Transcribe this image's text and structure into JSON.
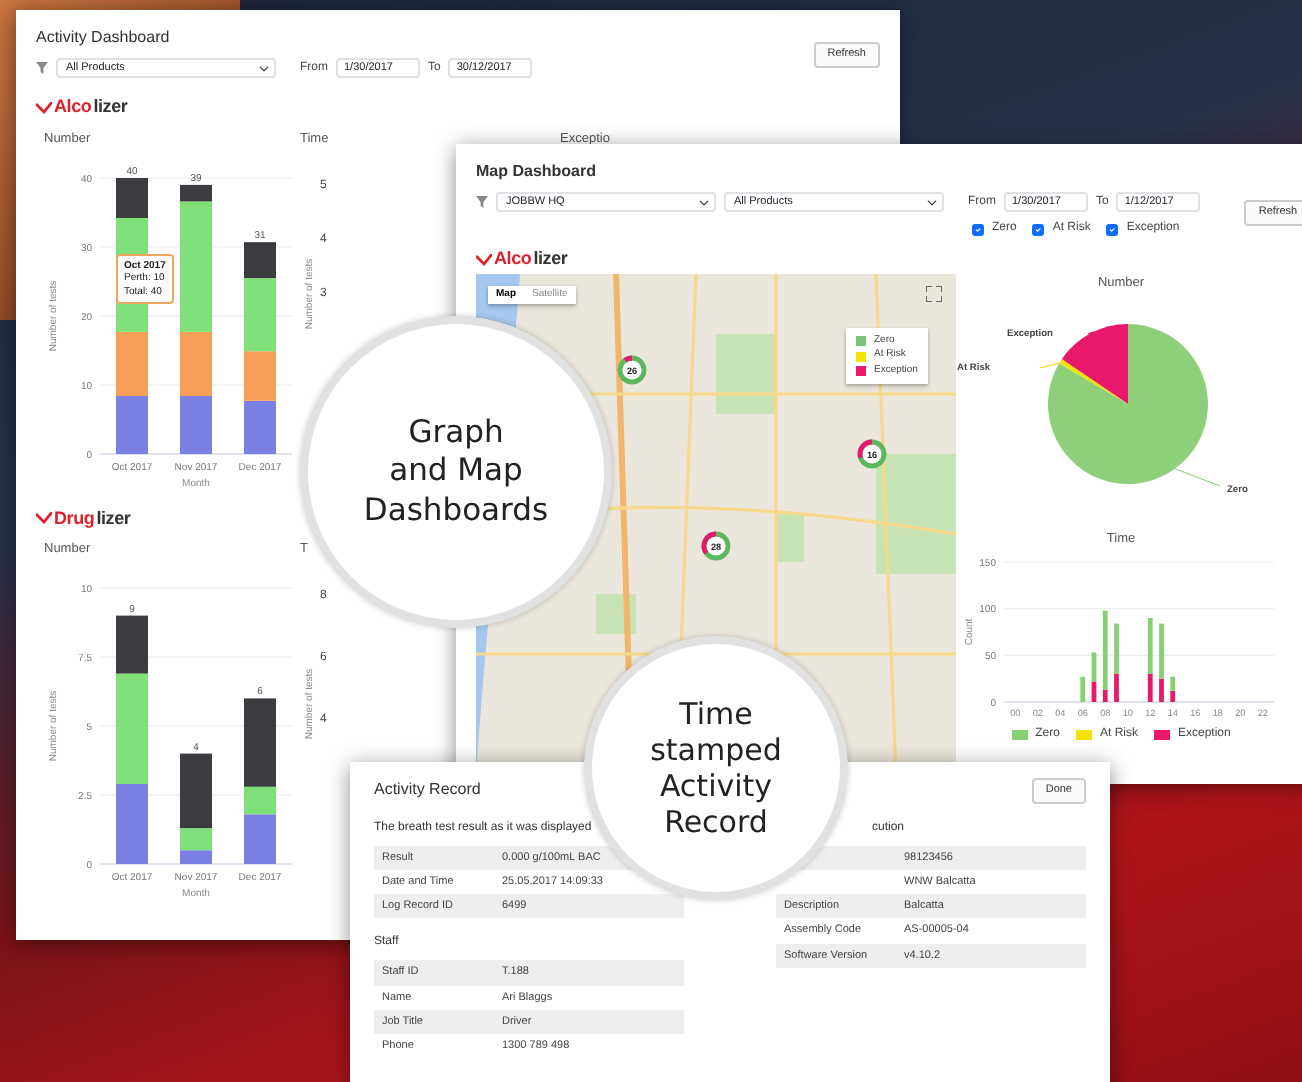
{
  "activity_dashboard": {
    "title": "Activity Dashboard",
    "product": "All Products",
    "from_label": "From",
    "from": "1/30/2017",
    "to_label": "To",
    "to": "30/12/2017",
    "refresh": "Refresh",
    "alcolizer": {
      "logo": {
        "accent": "Alco",
        "rest": "lizer"
      },
      "number_title": "Number",
      "tooltip": [
        "Oct 2017",
        "Perth: 10",
        "Total: 40"
      ],
      "chart_data": {
        "type": "bar",
        "stacked": true,
        "grid": true,
        "xlabel": "Month",
        "ylabel": "Number of tests",
        "categories": [
          "Oct 2017",
          "Nov 2017",
          "Dec 2017"
        ],
        "ylim": [
          0,
          40
        ],
        "yticks": [
          0,
          10,
          20,
          30,
          40
        ],
        "value_labels": [
          "40",
          "39",
          "31"
        ],
        "series": [
          {
            "color": "#7b7fe3",
            "values": [
              8.4,
              8.4,
              7.7
            ]
          },
          {
            "color": "#f5a05a",
            "values": [
              9.3,
              9.3,
              7.2
            ]
          },
          {
            "color": "#7fe07a",
            "values": [
              16.5,
              18.9,
              10.6
            ]
          },
          {
            "color": "#3b3b40",
            "values": [
              5.8,
              2.4,
              5.2
            ]
          }
        ]
      },
      "time_title": "Time",
      "time_ylabel": "Number of tests",
      "time_ticks": [
        "5",
        "4",
        "3"
      ],
      "exception_title": "Exceptio"
    },
    "druglizer": {
      "logo": {
        "accent": "Drug",
        "rest": "lizer"
      },
      "number_title": "Number",
      "chart_data": {
        "type": "bar",
        "stacked": true,
        "grid": true,
        "xlabel": "Month",
        "ylabel": "Number of tests",
        "categories": [
          "Oct 2017",
          "Nov 2017",
          "Dec 2017"
        ],
        "ylim": [
          0,
          10
        ],
        "yticks": [
          0,
          2.5,
          5,
          7.5,
          10
        ],
        "value_labels": [
          "9",
          "4",
          "6"
        ],
        "series": [
          {
            "color": "#7b7fe3",
            "values": [
              2.9,
              0.5,
              1.8
            ]
          },
          {
            "color": "#7fe07a",
            "values": [
              4.0,
              0.8,
              1.0
            ]
          },
          {
            "color": "#3b3b40",
            "values": [
              2.1,
              2.7,
              3.2
            ]
          }
        ]
      },
      "time_title": "T",
      "time_ylabel": "Number of tests",
      "time_ticks": [
        "8",
        "6",
        "4"
      ]
    }
  },
  "map_dashboard": {
    "title": "Map Dashboard",
    "site": "JOBBW HQ",
    "product": "All Products",
    "from_label": "From",
    "from": "1/30/2017",
    "to_label": "To",
    "to": "1/12/2017",
    "refresh": "Refresh",
    "filters": [
      {
        "label": "Zero",
        "checked": true
      },
      {
        "label": "At Risk",
        "checked": true
      },
      {
        "label": "Exception",
        "checked": true
      }
    ],
    "logo": {
      "accent": "Alco",
      "rest": "lizer"
    },
    "map": {
      "modes": [
        {
          "label": "Map",
          "selected": true
        },
        {
          "label": "Satellite",
          "selected": false
        }
      ],
      "legend": [
        {
          "label": "Zero",
          "color": "#7cc576"
        },
        {
          "label": "At Risk",
          "color": "#f0e400"
        },
        {
          "label": "Exception",
          "color": "#e8196b"
        }
      ],
      "markers": [
        {
          "count": "26"
        },
        {
          "count": "16"
        },
        {
          "count": "28"
        }
      ]
    },
    "number_panel": {
      "title": "Number",
      "slice_labels": [
        "Exception",
        "At Risk",
        "Zero"
      ]
    },
    "time_panel": {
      "title": "Time",
      "chart_data": {
        "type": "bar",
        "stacked": true,
        "grid": true,
        "ylabel": "Count",
        "x": [
          6,
          7,
          8,
          9,
          12,
          13,
          14
        ],
        "xlim": [
          -1,
          23
        ],
        "ylim": [
          0,
          150
        ],
        "yticks": [
          0,
          50,
          100,
          150
        ],
        "xticks": [
          {
            "value": 0,
            "label": "00"
          },
          {
            "value": 2,
            "label": "02"
          },
          {
            "value": 4,
            "label": "04"
          },
          {
            "value": 6,
            "label": "06"
          },
          {
            "value": 8,
            "label": "08"
          },
          {
            "value": 10,
            "label": "10"
          },
          {
            "value": 12,
            "label": "12"
          },
          {
            "value": 14,
            "label": "14"
          },
          {
            "value": 16,
            "label": "16"
          },
          {
            "value": 18,
            "label": "18"
          },
          {
            "value": 20,
            "label": "20"
          },
          {
            "value": 22,
            "label": "22"
          }
        ],
        "series": [
          {
            "name": "Exception",
            "color": "#e8196b",
            "values": [
              0,
              22,
              13,
              30,
              30,
              25,
              12
            ]
          },
          {
            "name": "At Risk",
            "color": "#f0e400",
            "values": [
              0,
              0,
              0,
              0,
              0,
              0,
              0
            ]
          },
          {
            "name": "Zero",
            "color": "#86cf72",
            "values": [
              27,
              31,
              85,
              54,
              60,
              59,
              15
            ]
          }
        ]
      }
    }
  },
  "activity_record": {
    "title": "Activity Record",
    "button": "Done",
    "result_heading": "The breath test result as it was displayed",
    "result_rows": [
      {
        "label": "Result",
        "value": "0.000 g/100mL BAC"
      },
      {
        "label": "Date and Time",
        "value": "25.05.2017 14:09:33"
      },
      {
        "label": "Log Record ID",
        "value": "6499"
      }
    ],
    "staff_heading": "Staff",
    "staff_rows": [
      {
        "label": "Staff ID",
        "value": "T.188"
      },
      {
        "label": "Name",
        "value": "Ari Blaggs"
      },
      {
        "label": "Job Title",
        "value": "Driver"
      },
      {
        "label": "Phone",
        "value": "1300 789 498"
      }
    ],
    "device_heading": "cution",
    "device_rows": [
      {
        "value": "98123456"
      },
      {
        "value": "WNW Balcatta"
      },
      {
        "label": "Description",
        "value": "Balcatta"
      },
      {
        "label": "Assembly Code",
        "value": "AS-00005-04"
      },
      {
        "label": "Software Version",
        "value": "v4.10.2"
      }
    ]
  },
  "captions": [
    {
      "lines": [
        "Graph",
        "and Map",
        "Dashboards"
      ]
    },
    {
      "lines": [
        "Time",
        "stamped",
        "Activity",
        "Record"
      ]
    }
  ]
}
